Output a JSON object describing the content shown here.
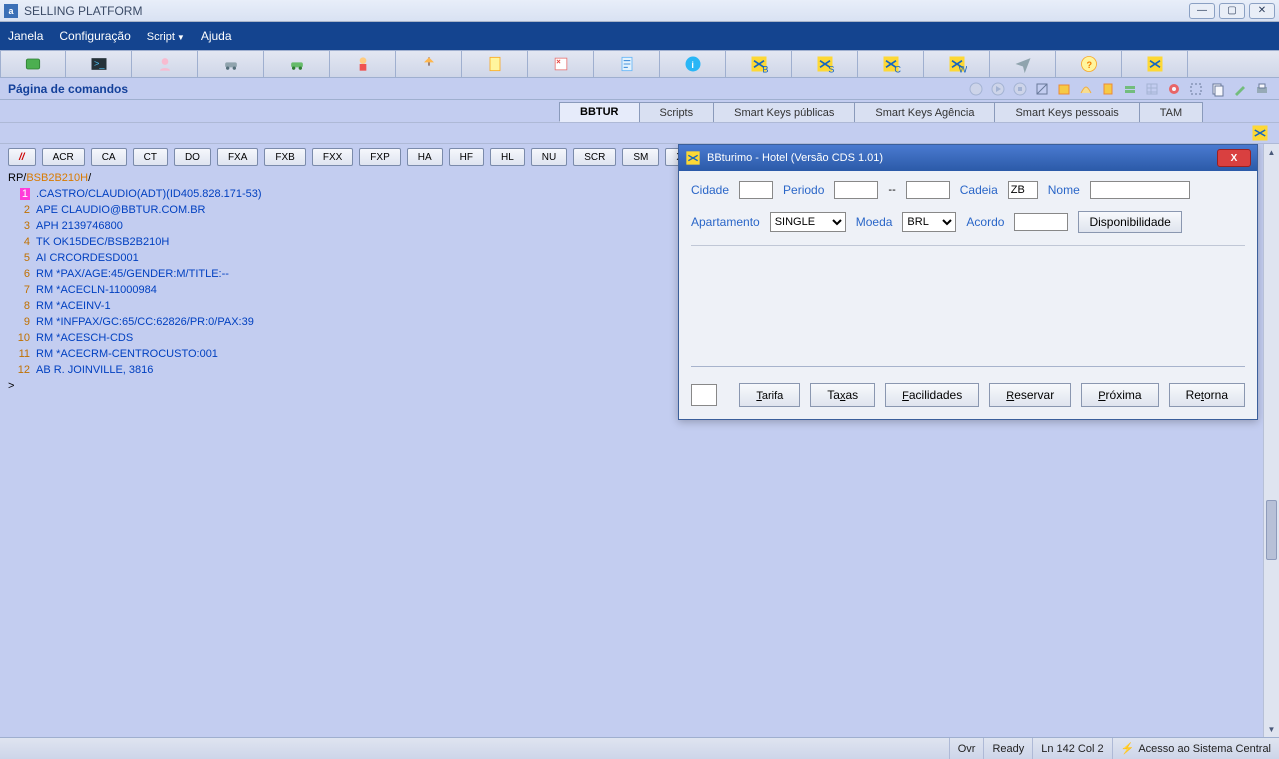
{
  "window": {
    "title": "SELLING PLATFORM"
  },
  "menu": {
    "janela": "Janela",
    "config": "Configuração",
    "script": "Script",
    "ajuda": "Ajuda"
  },
  "cmdpage": {
    "label": "Página de comandos"
  },
  "tabs": {
    "bbtur": "BBTUR",
    "scripts": "Scripts",
    "skpub": "Smart Keys públicas",
    "skag": "Smart Keys Agência",
    "skpes": "Smart Keys pessoais",
    "tam": "TAM"
  },
  "quick": {
    "slash": "//",
    "acr": "ACR",
    "ca": "CA",
    "ct": "CT",
    "do": "DO",
    "fxa": "FXA",
    "fxb": "FXB",
    "fxx": "FXX",
    "fxp": "FXP",
    "ha": "HA",
    "hf": "HF",
    "hl": "HL",
    "nu": "NU",
    "scr": "SCR",
    "sm": "SM",
    "xe": "XE"
  },
  "pnr": {
    "prefix": "RP/",
    "locator": "BSB2B210H",
    "suffix": "/",
    "cursor": "1",
    "l1": ".CASTRO/CLAUDIO(ADT)(ID405.828.171-53)",
    "l2": "APE CLAUDIO@BBTUR.COM.BR",
    "l3": "APH 2139746800",
    "l4": "TK OK15DEC/BSB2B210H",
    "l5": "AI CRCORDESD001",
    "l6": "RM *PAX/AGE:45/GENDER:M/TITLE:--",
    "l7": "RM *ACECLN-11000984",
    "l8": "RM *ACEINV-1",
    "l9": "RM *INFPAX/GC:65/CC:62826/PR:0/PAX:39",
    "l10": "RM *ACESCH-CDS",
    "l11": "RM *ACECRM-CENTROCUSTO:001",
    "l12": "AB R. JOINVILLE, 3816",
    "prompt": ">"
  },
  "lineno": {
    "n2": "2",
    "n3": "3",
    "n4": "4",
    "n5": "5",
    "n6": "6",
    "n7": "7",
    "n8": "8",
    "n9": "9",
    "n10": "10",
    "n11": "11",
    "n12": "12"
  },
  "popup": {
    "title": "BBturimo - Hotel (Versão CDS 1.01)",
    "cidade": "Cidade",
    "periodo": "Periodo",
    "sep": "--",
    "cadeia": "Cadeia",
    "cadeia_val": "ZB",
    "nome": "Nome",
    "apartamento": "Apartamento",
    "apart_val": "SINGLE",
    "moeda": "Moeda",
    "moeda_val": "BRL",
    "acordo": "Acordo",
    "disponibilidade": "Disponibilidade",
    "tarifa": "Tarifa",
    "taxas": "Taxas",
    "facilidades": "Facilidades",
    "reservar": "Reservar",
    "proxima": "Próxima",
    "retorna": "Retorna"
  },
  "status": {
    "ovr": "Ovr",
    "ready": "Ready",
    "pos": "Ln 142 Col 2",
    "acesso": "Acesso ao Sistema Central"
  }
}
